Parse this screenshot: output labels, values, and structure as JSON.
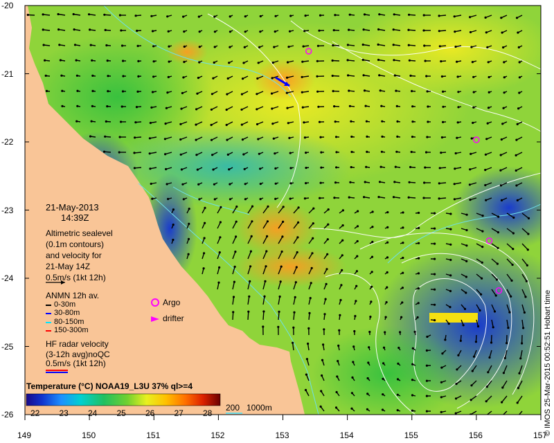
{
  "map": {
    "date": "21-May-2013",
    "time": "14:39Z",
    "y_axis": {
      "min": -26,
      "max": -20,
      "ticks": [
        "-20",
        "-21",
        "-22",
        "-23",
        "-24",
        "-25",
        "-26"
      ]
    },
    "x_axis": {
      "min": 149,
      "max": 157,
      "ticks": [
        "149",
        "150",
        "151",
        "152",
        "153",
        "154",
        "155",
        "156",
        "157"
      ]
    },
    "altimetry_note": [
      "Altimetric sealevel",
      "(0.1m contours)",
      "and velocity for",
      "21-May 14Z"
    ],
    "altimetry_scale": "0.5m/s (1kt 12h)",
    "anmn": {
      "title": "ANMN 12h av.",
      "items": [
        {
          "label": "0-30m",
          "color": "#000000"
        },
        {
          "label": "30-80m",
          "color": "#0000ff"
        },
        {
          "label": "80-150m",
          "color": "#00e5ff"
        },
        {
          "label": "150-300m",
          "color": "#ff0000"
        }
      ]
    },
    "argo_label": "Argo",
    "drifter_label": "drifter",
    "argo_color": "#ff00ff",
    "hf_note": [
      "HF radar velocity",
      "(3-12h avg)noQC"
    ],
    "hf_scale": "0.5m/s (1kt 12h)",
    "colorbar": {
      "title": "Temperature (°C) NOAA19_L3U 37% ql>=4",
      "labels": [
        "22",
        "23",
        "24",
        "25",
        "26",
        "27",
        "28"
      ]
    },
    "bathy": {
      "label_200": "200",
      "label_1000": "1000m"
    },
    "credit": "© IMOS 25-Mar-2015 00:52:51 Hobart time",
    "land_color": "#f9c597",
    "argo_floats": [
      {
        "lon": 153.4,
        "lat": -20.67
      },
      {
        "lon": 156.0,
        "lat": -21.97
      },
      {
        "lon": 156.2,
        "lat": -23.45
      },
      {
        "lon": 156.35,
        "lat": -24.18
      }
    ]
  }
}
